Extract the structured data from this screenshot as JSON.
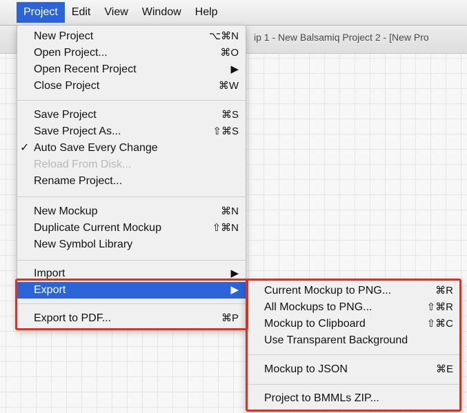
{
  "menubar": {
    "items": [
      "Project",
      "Edit",
      "View",
      "Window",
      "Help"
    ],
    "active": "Project"
  },
  "window": {
    "title": "ip 1 - New Balsamiq Project 2 - [New Pro"
  },
  "project_menu": {
    "items": [
      {
        "label": "New Project",
        "shortcut": "⌥⌘N"
      },
      {
        "label": "Open Project...",
        "shortcut": "⌘O"
      },
      {
        "label": "Open Recent Project",
        "shortcut": "▶"
      },
      {
        "label": "Close Project",
        "shortcut": "⌘W"
      },
      {
        "label": "Save Project",
        "shortcut": "⌘S"
      },
      {
        "label": "Save Project As...",
        "shortcut": "⇧⌘S"
      },
      {
        "label": "Auto Save Every Change",
        "shortcut": "",
        "check": "✓"
      },
      {
        "label": "Reload From Disk...",
        "shortcut": ""
      },
      {
        "label": "Rename Project...",
        "shortcut": ""
      },
      {
        "label": "New Mockup",
        "shortcut": "⌘N"
      },
      {
        "label": "Duplicate Current Mockup",
        "shortcut": "⇧⌘N"
      },
      {
        "label": "New Symbol Library",
        "shortcut": ""
      },
      {
        "label": "Import",
        "shortcut": "▶"
      },
      {
        "label": "Export",
        "shortcut": "▶"
      },
      {
        "label": "Export to PDF...",
        "shortcut": "⌘P"
      }
    ]
  },
  "export_menu": {
    "items": [
      {
        "label": "Current Mockup to PNG...",
        "shortcut": "⌘R"
      },
      {
        "label": "All Mockups to PNG...",
        "shortcut": "⇧⌘R"
      },
      {
        "label": "Mockup to Clipboard",
        "shortcut": "⇧⌘C"
      },
      {
        "label": "Use Transparent Background",
        "shortcut": ""
      },
      {
        "label": "Mockup to JSON",
        "shortcut": "⌘E"
      },
      {
        "label": "Project to BMMLs ZIP...",
        "shortcut": ""
      }
    ]
  },
  "colors": {
    "highlight": "#2b64d8",
    "annotation_red": "#d9321f",
    "toolbar": "#3a3a3a"
  }
}
